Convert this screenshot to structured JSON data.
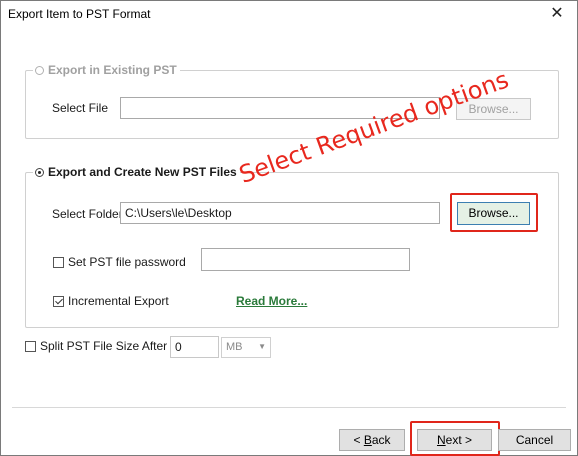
{
  "window": {
    "title": "Export Item to PST Format",
    "close_glyph": "✕"
  },
  "existing": {
    "legend": "Export in Existing PST",
    "select_file_label": "Select File",
    "select_file_value": "",
    "browse_label": "Browse..."
  },
  "create": {
    "legend": "Export and Create New  PST Files",
    "select_folder_label": "Select Folder",
    "select_folder_value": "C:\\Users\\le\\Desktop",
    "browse_label": "Browse...",
    "password_label": "Set PST file password",
    "password_value": "",
    "incremental_label": "Incremental Export",
    "read_more_label": "Read More..."
  },
  "split": {
    "label": "Split PST File Size After",
    "value": "0",
    "unit": "MB"
  },
  "annotation": {
    "text": "Select Required options",
    "color": "#e8281e"
  },
  "footer": {
    "back_lead": "< ",
    "back_key": "B",
    "back_rest": "ack",
    "next_lead": "",
    "next_key": "N",
    "next_rest": "ext >",
    "cancel_label": "Cancel"
  },
  "colors": {
    "link": "#2a7a3a",
    "highlight_button": "#e5f1e5",
    "highlight_border": "#e0261b"
  }
}
